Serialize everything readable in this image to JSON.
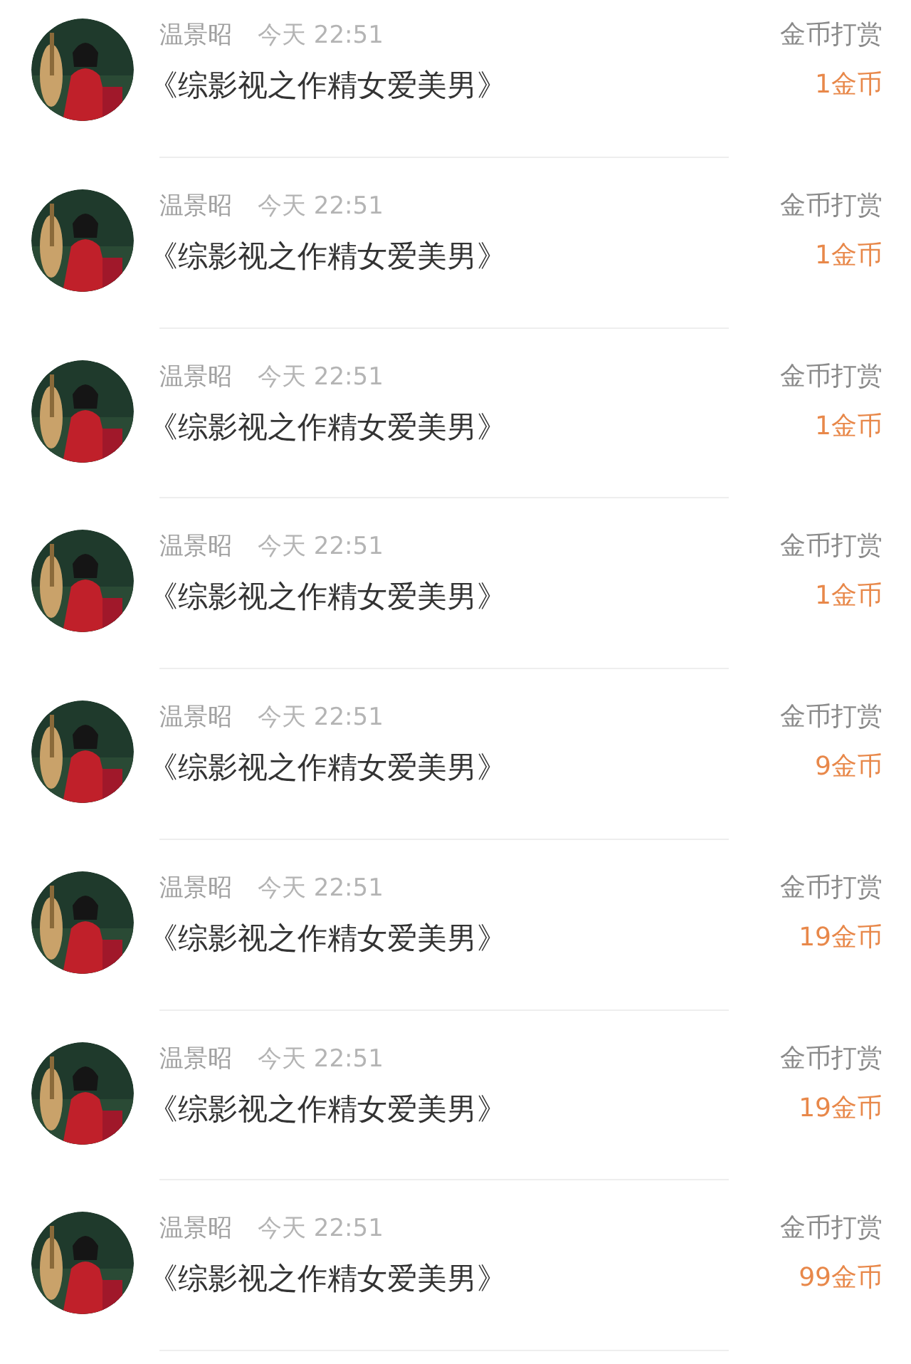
{
  "records": [
    {
      "name": "温景昭",
      "time": "今天 22:51",
      "title": "《综影视之作精女爱美男》",
      "label": "金币打赏",
      "amount": "1金币"
    },
    {
      "name": "温景昭",
      "time": "今天 22:51",
      "title": "《综影视之作精女爱美男》",
      "label": "金币打赏",
      "amount": "1金币"
    },
    {
      "name": "温景昭",
      "time": "今天 22:51",
      "title": "《综影视之作精女爱美男》",
      "label": "金币打赏",
      "amount": "1金币"
    },
    {
      "name": "温景昭",
      "time": "今天 22:51",
      "title": "《综影视之作精女爱美男》",
      "label": "金币打赏",
      "amount": "1金币"
    },
    {
      "name": "温景昭",
      "time": "今天 22:51",
      "title": "《综影视之作精女爱美男》",
      "label": "金币打赏",
      "amount": "9金币"
    },
    {
      "name": "温景昭",
      "time": "今天 22:51",
      "title": "《综影视之作精女爱美男》",
      "label": "金币打赏",
      "amount": "19金币"
    },
    {
      "name": "温景昭",
      "time": "今天 22:51",
      "title": "《综影视之作精女爱美男》",
      "label": "金币打赏",
      "amount": "19金币"
    },
    {
      "name": "温景昭",
      "time": "今天 22:51",
      "title": "《综影视之作精女爱美男》",
      "label": "金币打赏",
      "amount": "99金币"
    }
  ]
}
